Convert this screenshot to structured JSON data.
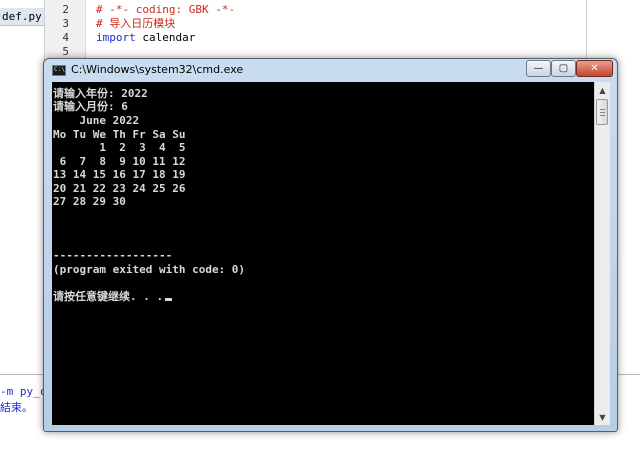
{
  "ide": {
    "file_tab": "def.py",
    "line_numbers": [
      "2",
      "3",
      "4",
      "5"
    ],
    "code_lines": [
      {
        "text": "# -*- coding: GBK -*-",
        "kind": "comment"
      },
      {
        "text": "# 导入日历模块",
        "kind": "comment"
      },
      {
        "text": "calendar",
        "keyword": "import",
        "kind": "import"
      },
      {
        "text": "",
        "kind": "plain"
      }
    ],
    "output_lines": [
      "-m py_co",
      "結束。"
    ]
  },
  "cmd": {
    "title": "C:\\Windows\\system32\\cmd.exe",
    "icon_glyph": "C:\\",
    "minimize_glyph": "—",
    "maximize_glyph": "▢",
    "close_glyph": "✕",
    "lines": [
      "请输入年份: 2022",
      "请输入月份: 6",
      "    June 2022",
      "Mo Tu We Th Fr Sa Su",
      "       1  2  3  4  5",
      " 6  7  8  9 10 11 12",
      "13 14 15 16 17 18 19",
      "20 21 22 23 24 25 26",
      "27 28 29 30",
      "",
      "",
      "",
      "------------------",
      "(program exited with code: 0)",
      "",
      "请按任意键继续. . ."
    ]
  },
  "colors": {
    "console_bg": "#000000",
    "console_text": "#d8d8d8",
    "comment": "#cc2a1a",
    "keyword": "#1f2bd0"
  }
}
